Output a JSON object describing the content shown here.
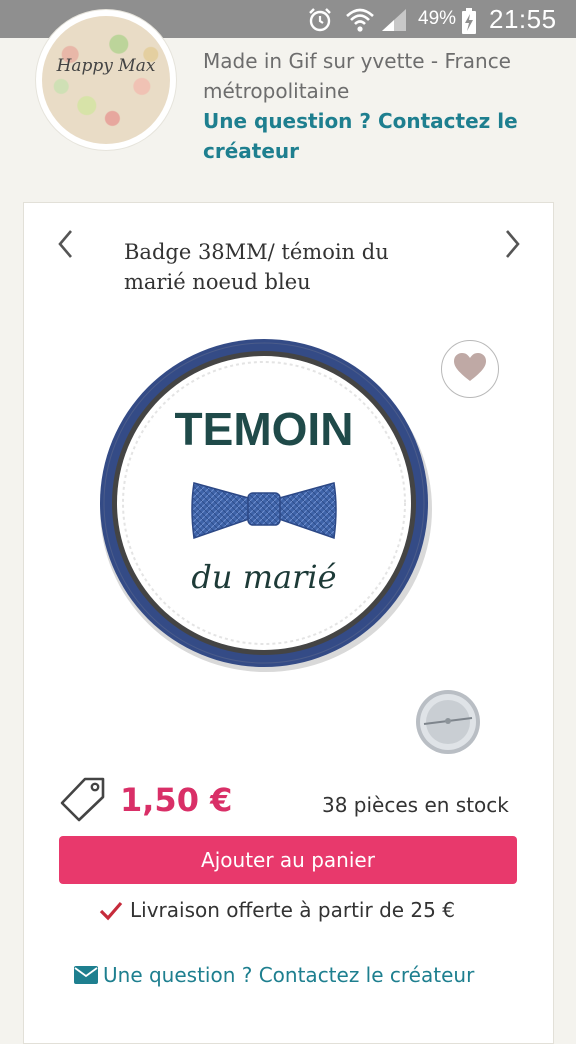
{
  "status_bar": {
    "battery_percent": "49%",
    "time": "21:55",
    "icons": [
      "alarm-icon",
      "wifi-icon",
      "signal-icon",
      "battery-charging-icon"
    ],
    "background_color": "#8f8f8f"
  },
  "shop": {
    "logo_text": "Happy Max",
    "location": "Made in Gif sur yvette - France métropolitaine",
    "contact_link": "Une question ? Contactez le créateur"
  },
  "product": {
    "title": "Badge 38MM/ témoin du marié noeud bleu",
    "badge_title": "TEMOIN",
    "badge_subtitle": "du marié",
    "price": "1,50 €",
    "stock": "38 pièces en stock",
    "add_to_cart_label": "Ajouter au panier",
    "free_shipping": "Livraison offerte à partir de 25 €",
    "contact_link": "Une question ? Contactez le créateur",
    "icons": [
      "chevron-left-icon",
      "chevron-right-icon",
      "heart-icon",
      "price-tag-icon",
      "check-icon",
      "mail-icon"
    ]
  },
  "colors": {
    "accent_pink": "#e8396c",
    "price_pink": "#d92f67",
    "link_teal": "#1e7f8f",
    "page_background": "#f4f3ee"
  }
}
